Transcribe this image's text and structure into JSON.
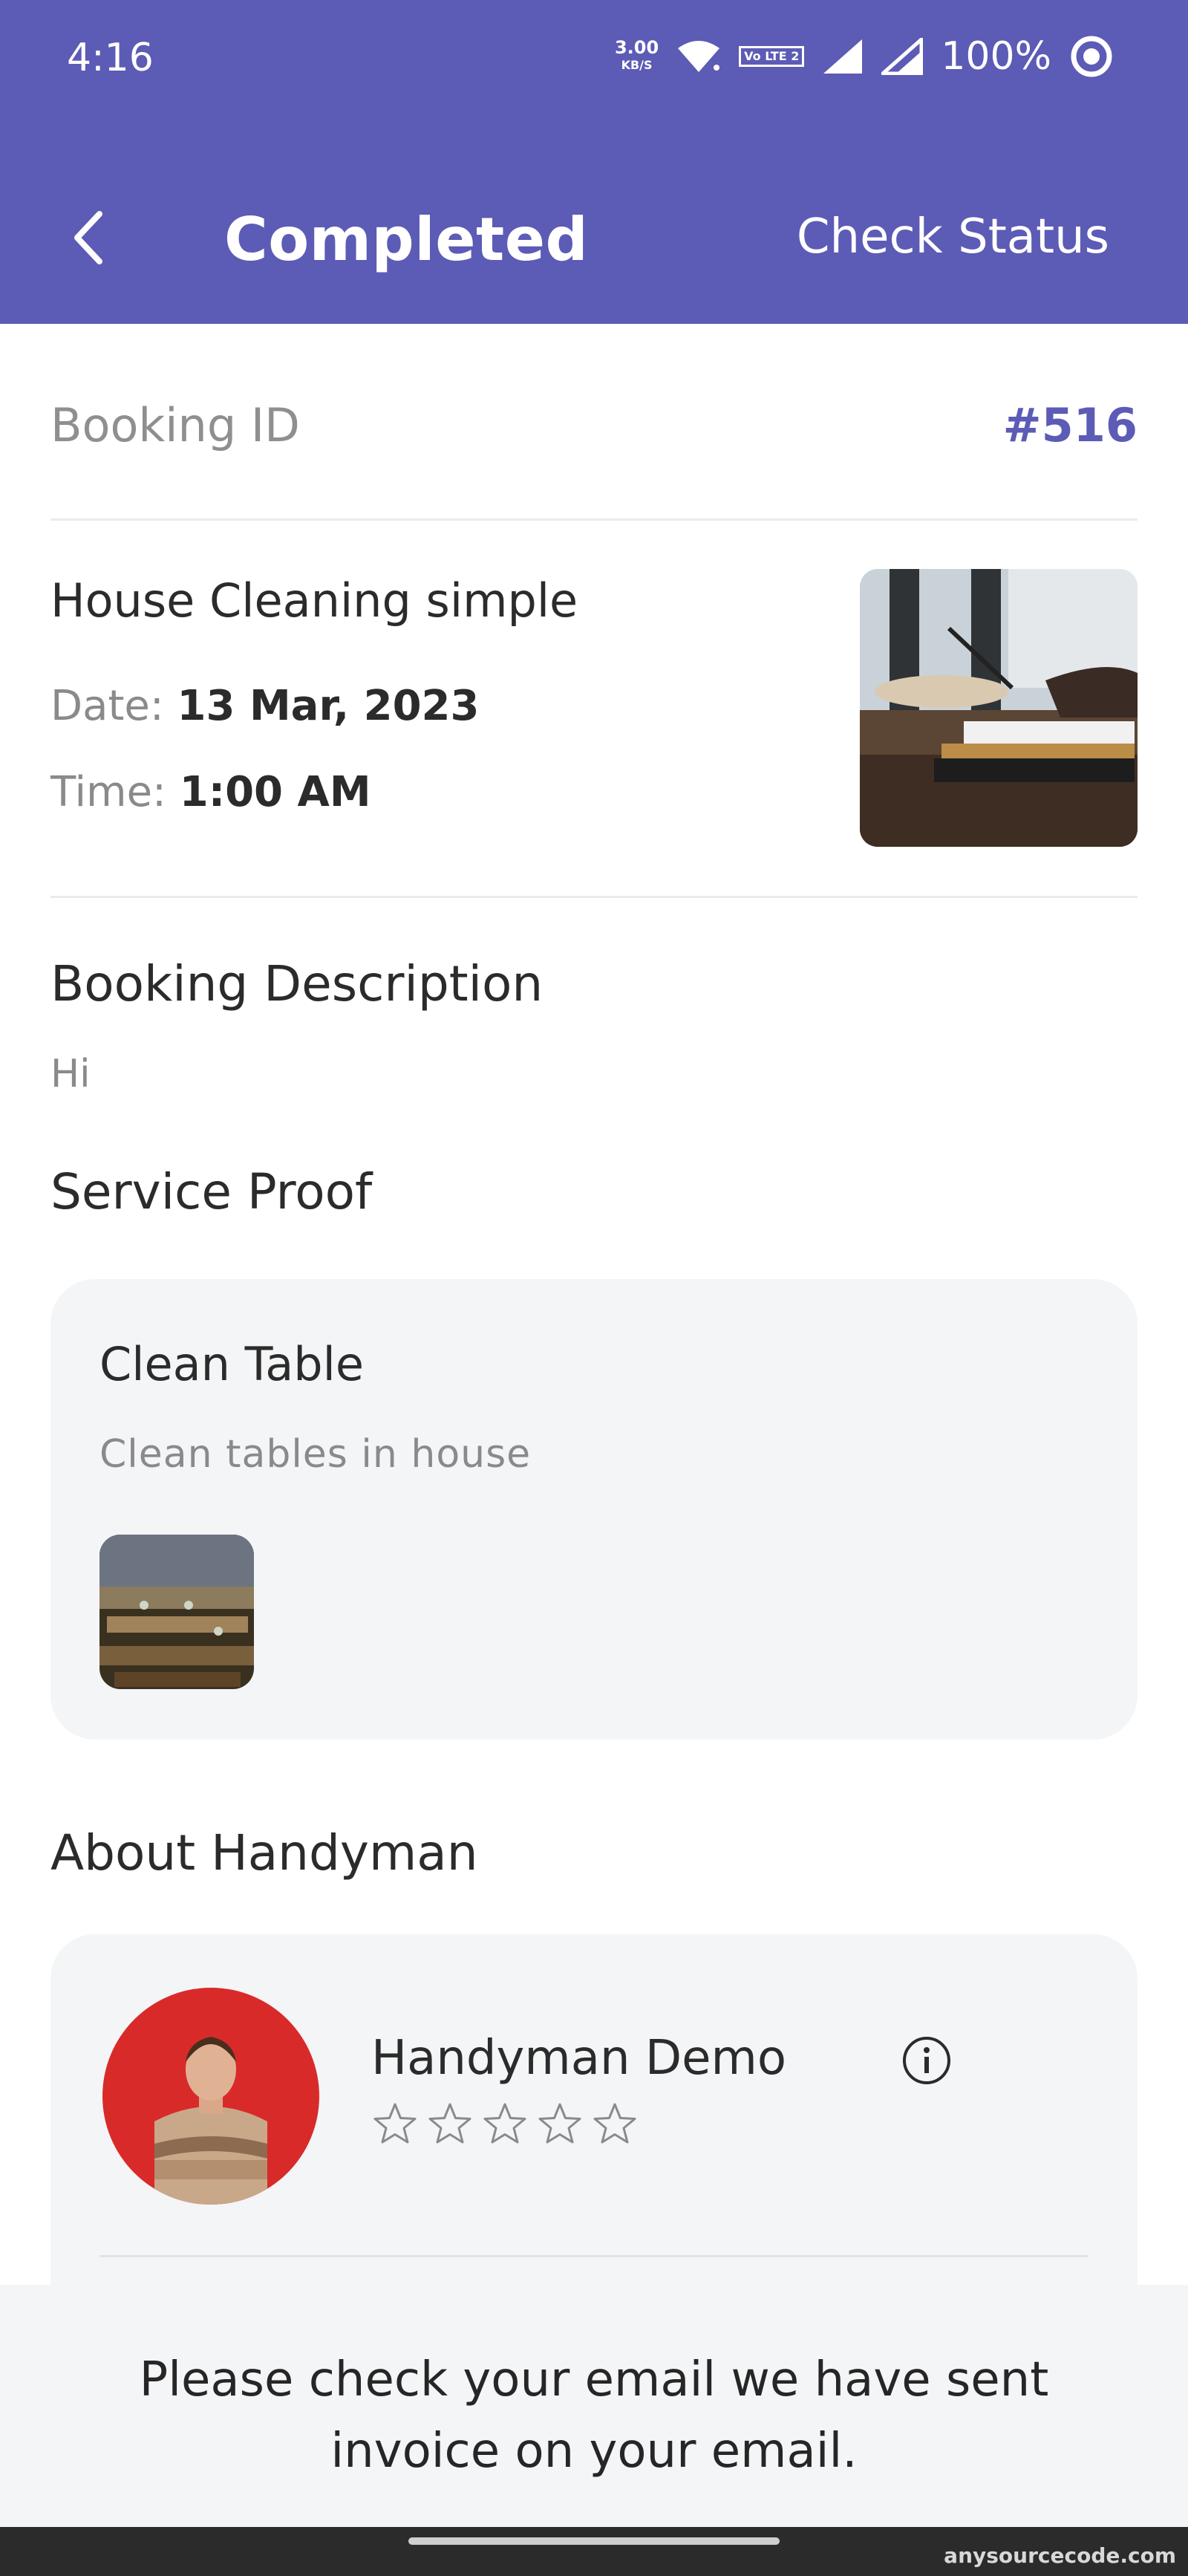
{
  "status_bar": {
    "time": "4:16",
    "net_speed_value": "3.00",
    "net_speed_unit": "KB/S",
    "volte_label": "Vo LTE 2",
    "battery": "100%"
  },
  "app_bar": {
    "title": "Completed",
    "check_status_label": "Check Status",
    "back_icon": "chevron-left-icon",
    "color": "#5c5bb5"
  },
  "booking": {
    "id_label": "Booking ID",
    "id_value": "#516",
    "service_name": "House Cleaning simple",
    "date_label": "Date:",
    "date_value": "13 Mar, 2023",
    "time_label": "Time:",
    "time_value": "1:00 AM"
  },
  "description": {
    "title": "Booking Description",
    "text": "Hi"
  },
  "service_proof": {
    "title": "Service Proof",
    "card_title": "Clean Table",
    "card_desc": "Clean tables in house"
  },
  "handyman": {
    "section_title": "About Handyman",
    "name": "Handyman Demo",
    "rating": 0,
    "max_rating": 5
  },
  "bottom_message": "Please check your email we have sent invoice on your email.",
  "watermark": "anysourcecode.com"
}
